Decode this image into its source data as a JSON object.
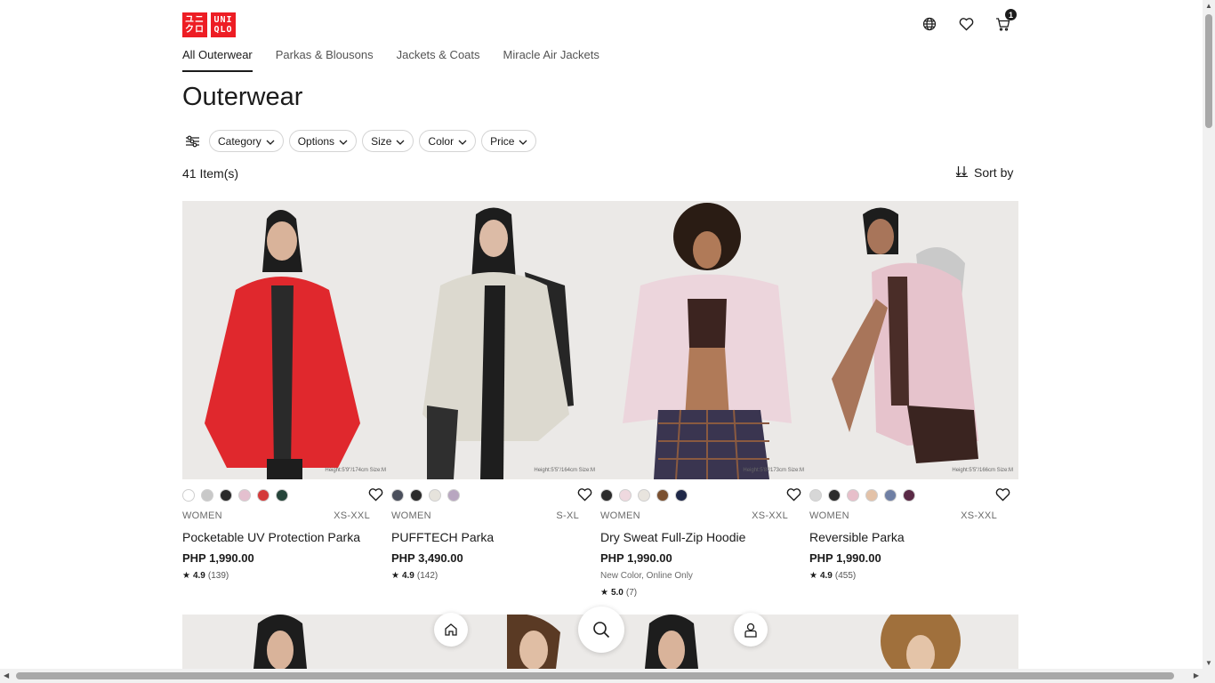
{
  "header": {
    "logo_top": "ユニ",
    "logo_bottom": "クロ",
    "logo_text_top": "UNI",
    "logo_text_bottom": "QLO",
    "cart_count": "1",
    "brand_color": "#ed1d24"
  },
  "tabs": [
    {
      "label": "All Outerwear",
      "active": true
    },
    {
      "label": "Parkas & Blousons",
      "active": false
    },
    {
      "label": "Jackets & Coats",
      "active": false
    },
    {
      "label": "Miracle Air Jackets",
      "active": false
    }
  ],
  "page_title": "Outerwear",
  "filters": [
    "Category",
    "Options",
    "Size",
    "Color",
    "Price"
  ],
  "item_count": "41 Item(s)",
  "sort_label": "Sort by",
  "products": [
    {
      "gender": "WOMEN",
      "sizes": "XS-XXL",
      "name": "Pocketable UV Protection Parka",
      "price": "PHP 1,990.00",
      "note": "",
      "rating": "4.9",
      "reviews": "(139)",
      "caption": "Height:5'9\"/174cm Size:M",
      "jacket_color": "#e0282d",
      "swatches": [
        "#ffffff",
        "#c8c8c8",
        "#2b2b2b",
        "#e4c0cf",
        "#d43a3a",
        "#26453a"
      ]
    },
    {
      "gender": "WOMEN",
      "sizes": "S-XL",
      "name": "PUFFTECH Parka",
      "price": "PHP 3,490.00",
      "note": "",
      "rating": "4.9",
      "reviews": "(142)",
      "caption": "Height:5'5\"/164cm Size:M",
      "jacket_color": "#dcd9cf",
      "swatches": [
        "#4a4f5c",
        "#2b2b2b",
        "#e6e3dc",
        "#b8a6c0"
      ]
    },
    {
      "gender": "WOMEN",
      "sizes": "XS-XXL",
      "name": "Dry Sweat Full-Zip Hoodie",
      "price": "PHP 1,990.00",
      "note": "New Color, Online Only",
      "rating": "5.0",
      "reviews": "(7)",
      "caption": "Height:5'8\"/173cm Size:M",
      "jacket_color": "#ecd5dc",
      "swatches": [
        "#2b2b2b",
        "#efd9df",
        "#e8e4de",
        "#7a5030",
        "#1f2848"
      ]
    },
    {
      "gender": "WOMEN",
      "sizes": "XS-XXL",
      "name": "Reversible Parka",
      "price": "PHP 1,990.00",
      "note": "",
      "rating": "4.9",
      "reviews": "(455)",
      "caption": "Height:5'5\"/166cm Size:M",
      "jacket_color": "#e6c3cc",
      "swatches": [
        "#d7d7d7",
        "#2b2b2b",
        "#e7bfca",
        "#e3c2a8",
        "#6f7fa4",
        "#5a2a46"
      ]
    }
  ],
  "bottom_nav": [
    "home-icon",
    "search-icon",
    "account-icon"
  ]
}
